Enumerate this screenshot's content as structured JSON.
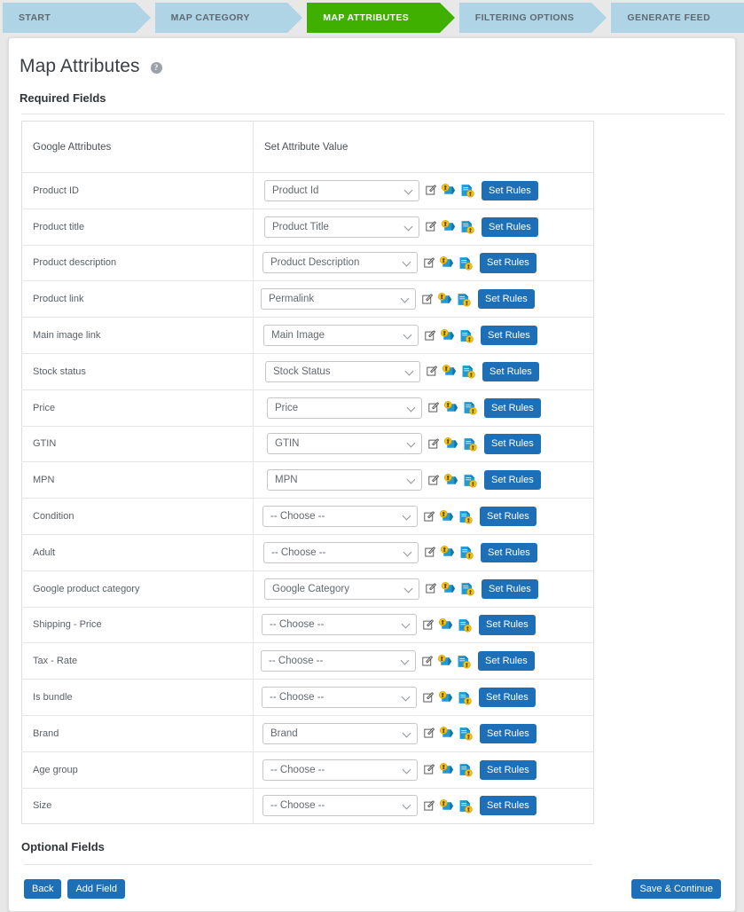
{
  "wizard": {
    "steps": [
      {
        "label": "START",
        "state": "done"
      },
      {
        "label": "MAP CATEGORY",
        "state": "done"
      },
      {
        "label": "MAP ATTRIBUTES",
        "state": "active"
      },
      {
        "label": "FILTERING OPTIONS",
        "state": "upcoming"
      },
      {
        "label": "GENERATE FEED",
        "state": "upcoming"
      }
    ],
    "active_color": "#40b000",
    "inactive_color": "#aed4e6"
  },
  "page": {
    "title": "Map Attributes",
    "help_icon": "help-circle-icon",
    "required_section_heading": "Required Fields",
    "optional_section_heading": "Optional Fields"
  },
  "table": {
    "headers": [
      "Google Attributes",
      "Set Attribute Value"
    ],
    "row_actions": {
      "edit_icon": "edit-pencil-square-icon",
      "tag_icon_1": "blue-tag-key-icon",
      "tag_icon_2": "blue-document-key-icon",
      "set_rules_label": "Set Rules"
    },
    "rows": [
      {
        "attribute": "Product ID",
        "value": "Product Id"
      },
      {
        "attribute": "Product title",
        "value": "Product Title"
      },
      {
        "attribute": "Product description",
        "value": "Product Description"
      },
      {
        "attribute": "Product link",
        "value": "Permalink"
      },
      {
        "attribute": "Main image link",
        "value": "Main Image"
      },
      {
        "attribute": "Stock status",
        "value": "Stock Status"
      },
      {
        "attribute": "Price",
        "value": "Price"
      },
      {
        "attribute": "GTIN",
        "value": "GTIN"
      },
      {
        "attribute": "MPN",
        "value": "MPN"
      },
      {
        "attribute": "Condition",
        "value": "-- Choose --"
      },
      {
        "attribute": "Adult",
        "value": "-- Choose --"
      },
      {
        "attribute": "Google product category",
        "value": "Google Category"
      },
      {
        "attribute": "Shipping - Price",
        "value": "-- Choose --"
      },
      {
        "attribute": "Tax - Rate",
        "value": "-- Choose --"
      },
      {
        "attribute": "Is bundle",
        "value": "-- Choose --"
      },
      {
        "attribute": "Brand",
        "value": "Brand"
      },
      {
        "attribute": "Age group",
        "value": "-- Choose --"
      },
      {
        "attribute": "Size",
        "value": "-- Choose --"
      }
    ]
  },
  "footer": {
    "back_label": "Back",
    "add_field_label": "Add Field",
    "save_continue_label": "Save & Continue"
  },
  "colors": {
    "primary_button": "#1d6fb8",
    "active_step": "#40b000",
    "step": "#aed4e6"
  }
}
